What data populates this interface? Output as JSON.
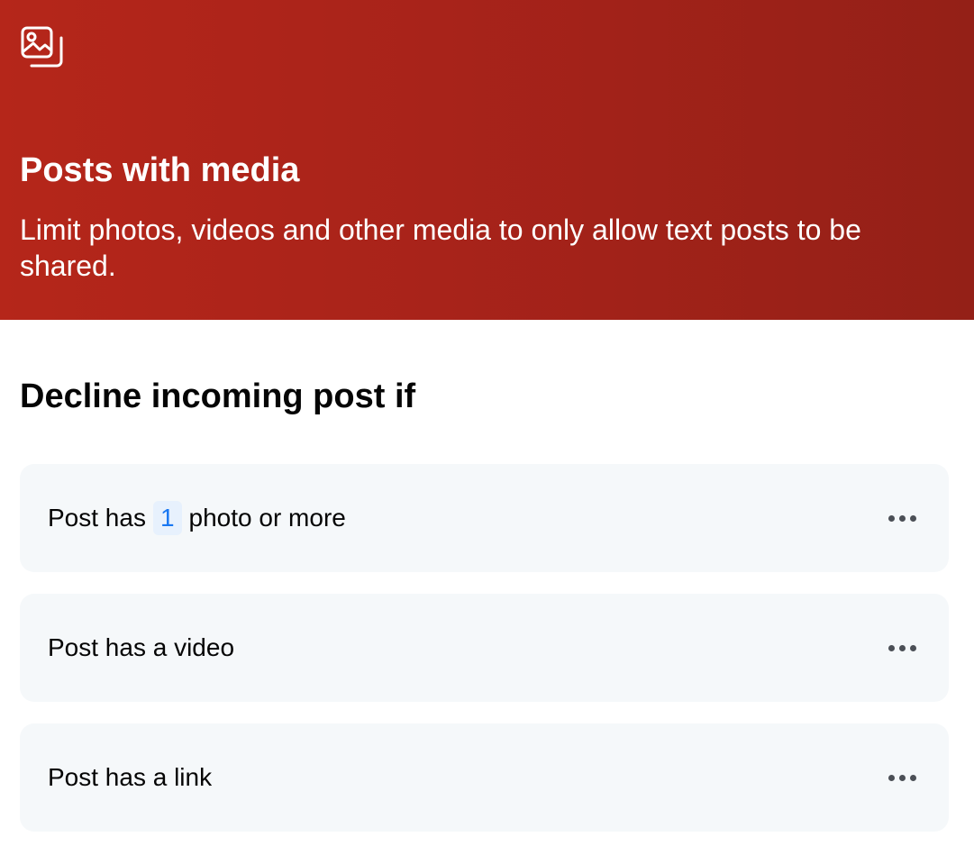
{
  "header": {
    "icon": "photos-icon",
    "title": "Posts with media",
    "description": "Limit photos, videos and other media to only allow text posts to be shared."
  },
  "section": {
    "title": "Decline incoming post if"
  },
  "rules": [
    {
      "prefix": "Post has",
      "count": "1",
      "suffix": "photo or more",
      "menu_icon": "more-options-icon"
    },
    {
      "text": "Post has a video",
      "menu_icon": "more-options-icon"
    },
    {
      "text": "Post has a link",
      "menu_icon": "more-options-icon"
    }
  ],
  "colors": {
    "header_bg": "#b5261a",
    "card_bg": "#f5f8fa",
    "chip_bg": "#e7f1fd",
    "chip_text": "#1877f2"
  }
}
